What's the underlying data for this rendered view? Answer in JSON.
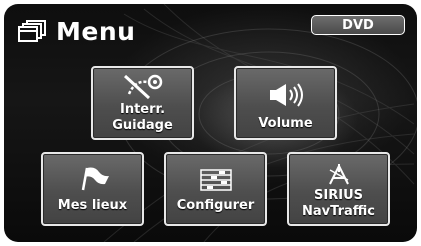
{
  "header": {
    "title": "Menu",
    "icon": "windows-icon"
  },
  "source_button": {
    "label": "DVD"
  },
  "tiles": [
    {
      "id": "guidance",
      "label": "Interr.\nGuidage",
      "icon": "cancel-route-icon"
    },
    {
      "id": "volume",
      "label": "Volume",
      "icon": "speaker-icon"
    },
    {
      "id": "places",
      "label": "Mes lieux",
      "icon": "flag-icon"
    },
    {
      "id": "config",
      "label": "Configurer",
      "icon": "settings-list-icon"
    },
    {
      "id": "sirius",
      "label": "SIRIUS\nNavTraffic",
      "icon": "satellite-antenna-icon"
    }
  ],
  "colors": {
    "background": "#101010",
    "tile": "#5a5a5a",
    "tile_border": "#e8e8e8",
    "text": "#ffffff"
  }
}
